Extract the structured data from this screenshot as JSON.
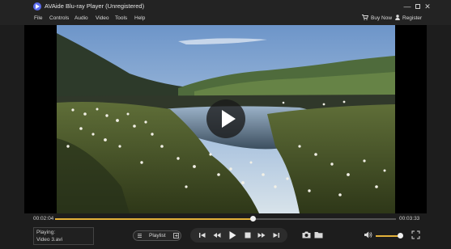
{
  "window": {
    "title": "AVAide Blu-ray Player (Unregistered)",
    "minimize_glyph": "—",
    "close_glyph": "✕"
  },
  "menu": {
    "items": [
      "File",
      "Controls",
      "Audio",
      "Video",
      "Tools",
      "Help"
    ],
    "buy_now": "Buy Now",
    "register": "Register"
  },
  "player": {
    "current_time": "00:02:04",
    "total_time": "00:03:33",
    "progress_fraction": 0.58,
    "volume_fraction": 0.85,
    "playing_label": "Playing:",
    "file_name": "Video 3.avi",
    "playlist_label": "Playlist"
  },
  "colors": {
    "accent": "#e3b13a",
    "logo": "#5b6cf0",
    "background": "#1d1d1d"
  },
  "icons": [
    "app-logo-icon",
    "minimize-icon",
    "maximize-icon",
    "close-icon",
    "cart-icon",
    "user-icon",
    "play-overlay-icon",
    "playlist-icon",
    "loop-icon",
    "skip-previous-icon",
    "rewind-icon",
    "play-icon",
    "stop-icon",
    "fast-forward-icon",
    "skip-next-icon",
    "snapshot-icon",
    "folder-icon",
    "volume-icon",
    "fullscreen-icon"
  ]
}
